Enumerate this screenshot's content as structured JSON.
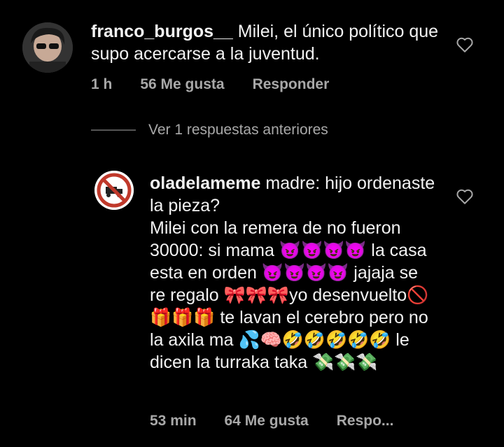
{
  "comments": [
    {
      "username": "franco_burgos__",
      "text": " Milei, el único político que supo acercarse a la juventud.",
      "time": "1 h",
      "likes": "56 Me gusta",
      "reply": "Responder"
    },
    {
      "username": "oladelameme",
      "text_lines": [
        " madre: hijo ordenaste la pieza?",
        "Milei con la remera de no fueron 30000: si mama 😈😈😈😈 la casa esta en orden 😈😈😈😈 jajaja se re regalo 🎀🎀🎀yo desenvuelto🚫🎁🎁🎁 te lavan el cerebro pero no la axila ma 💦🧠🤣🤣🤣🤣🤣 le dicen la turraka taka 💸💸💸"
      ],
      "time": "53 min",
      "likes": "64 Me gusta",
      "reply": "Respo..."
    }
  ],
  "replies_toggle": "Ver 1 respuestas anteriores",
  "icons": {
    "like": "heart-icon"
  },
  "colors": {
    "background": "#000000",
    "text": "#f2f2f2",
    "secondary": "#a8a8a8"
  }
}
